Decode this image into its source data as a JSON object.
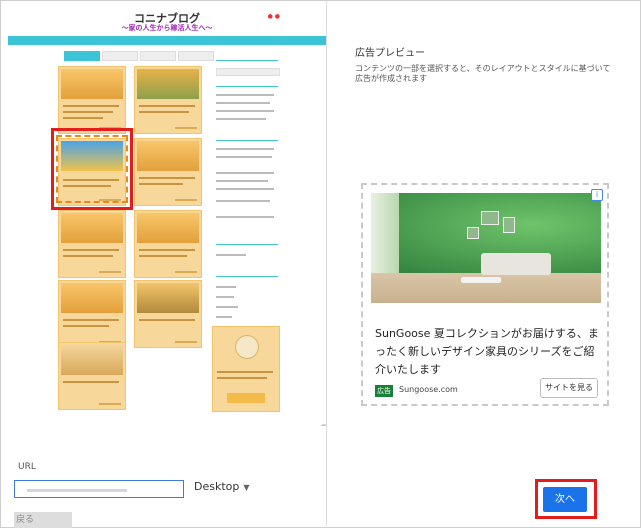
{
  "left_preview": {
    "site_title": "コニナブログ",
    "site_subtitle": "～家の人生から稼活人生へ～",
    "nav_items": [
      "",
      "",
      "",
      ""
    ],
    "tabs": [
      "",
      "",
      "",
      ""
    ],
    "sidebar_headings": [
      "",
      "",
      "",
      "",
      "",
      ""
    ]
  },
  "form": {
    "url_label": "URL",
    "url_value": "",
    "device_value": "Desktop",
    "cut_button_label": "戻る"
  },
  "preview": {
    "title": "広告プレビュー",
    "description": "コンテンツの一部を選択すると、そのレイアウトとスタイルに基づいて広告が作成されます",
    "ad": {
      "copy": "SunGoose 夏コレクションがお届けする、まったく新しいデザイン家具のシリーズをご紹介いたします",
      "badge": "広告",
      "domain": "Sungoose.com",
      "cta": "サイトを見る"
    },
    "next_label": "次へ"
  },
  "colors": {
    "accent": "#1a73e8",
    "highlight": "#e51c1c",
    "site_nav": "#3cc3d6",
    "card_bg": "#f8d89a"
  }
}
